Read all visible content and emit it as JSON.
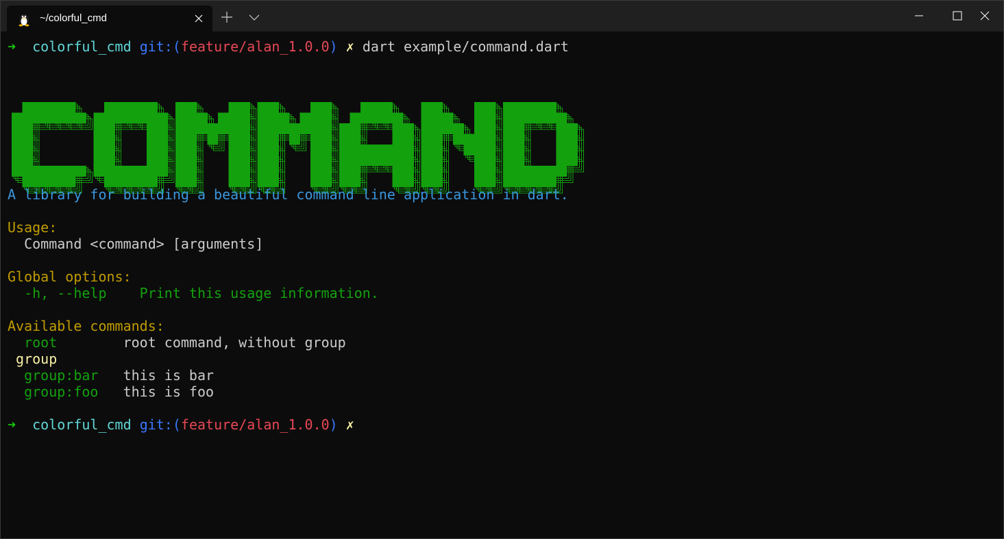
{
  "window": {
    "tab_title": "~/colorful_cmd"
  },
  "terminal": {
    "prompt1": {
      "arrow": "➜",
      "dir": "colorful_cmd",
      "git_prefix": "git:(",
      "branch": "feature/alan_1.0.0",
      "git_suffix": ")",
      "dirty": "✗",
      "command": "dart example/command.dart"
    },
    "banner_text": "COMMAND",
    "description": "A library for building a beautiful command line application in dart.",
    "usage_header": "Usage:",
    "usage_line": "  Command <command> [arguments]",
    "global_header": "Global options:",
    "global_flag": "  -h, --help    ",
    "global_desc": "Print this usage information.",
    "commands_header": "Available commands:",
    "commands": [
      {
        "name": "  root        ",
        "desc": "root command, without group"
      },
      {
        "group": " group"
      },
      {
        "name": "  group:bar   ",
        "desc": "this is bar"
      },
      {
        "name": "  group:foo   ",
        "desc": "this is foo"
      }
    ],
    "prompt2": {
      "arrow": "➜",
      "dir": "colorful_cmd",
      "git_prefix": "git:(",
      "branch": "feature/alan_1.0.0",
      "git_suffix": ")",
      "dirty": "✗"
    }
  },
  "colors": {
    "background": "#0c0c0c",
    "titlebar": "#202020",
    "green": "#13a10e",
    "cyan": "#61d6d6",
    "blue": "#3b78ff",
    "red": "#e74856",
    "yellow": "#c19c00",
    "light_blue": "#3a96dd"
  },
  "icons": {
    "tab_icon": "linux-penguin-icon",
    "close": "close-icon",
    "new_tab": "plus-icon",
    "dropdown": "chevron-down-icon",
    "minimize": "minimize-icon",
    "maximize": "maximize-icon",
    "window_close": "window-close-icon"
  }
}
